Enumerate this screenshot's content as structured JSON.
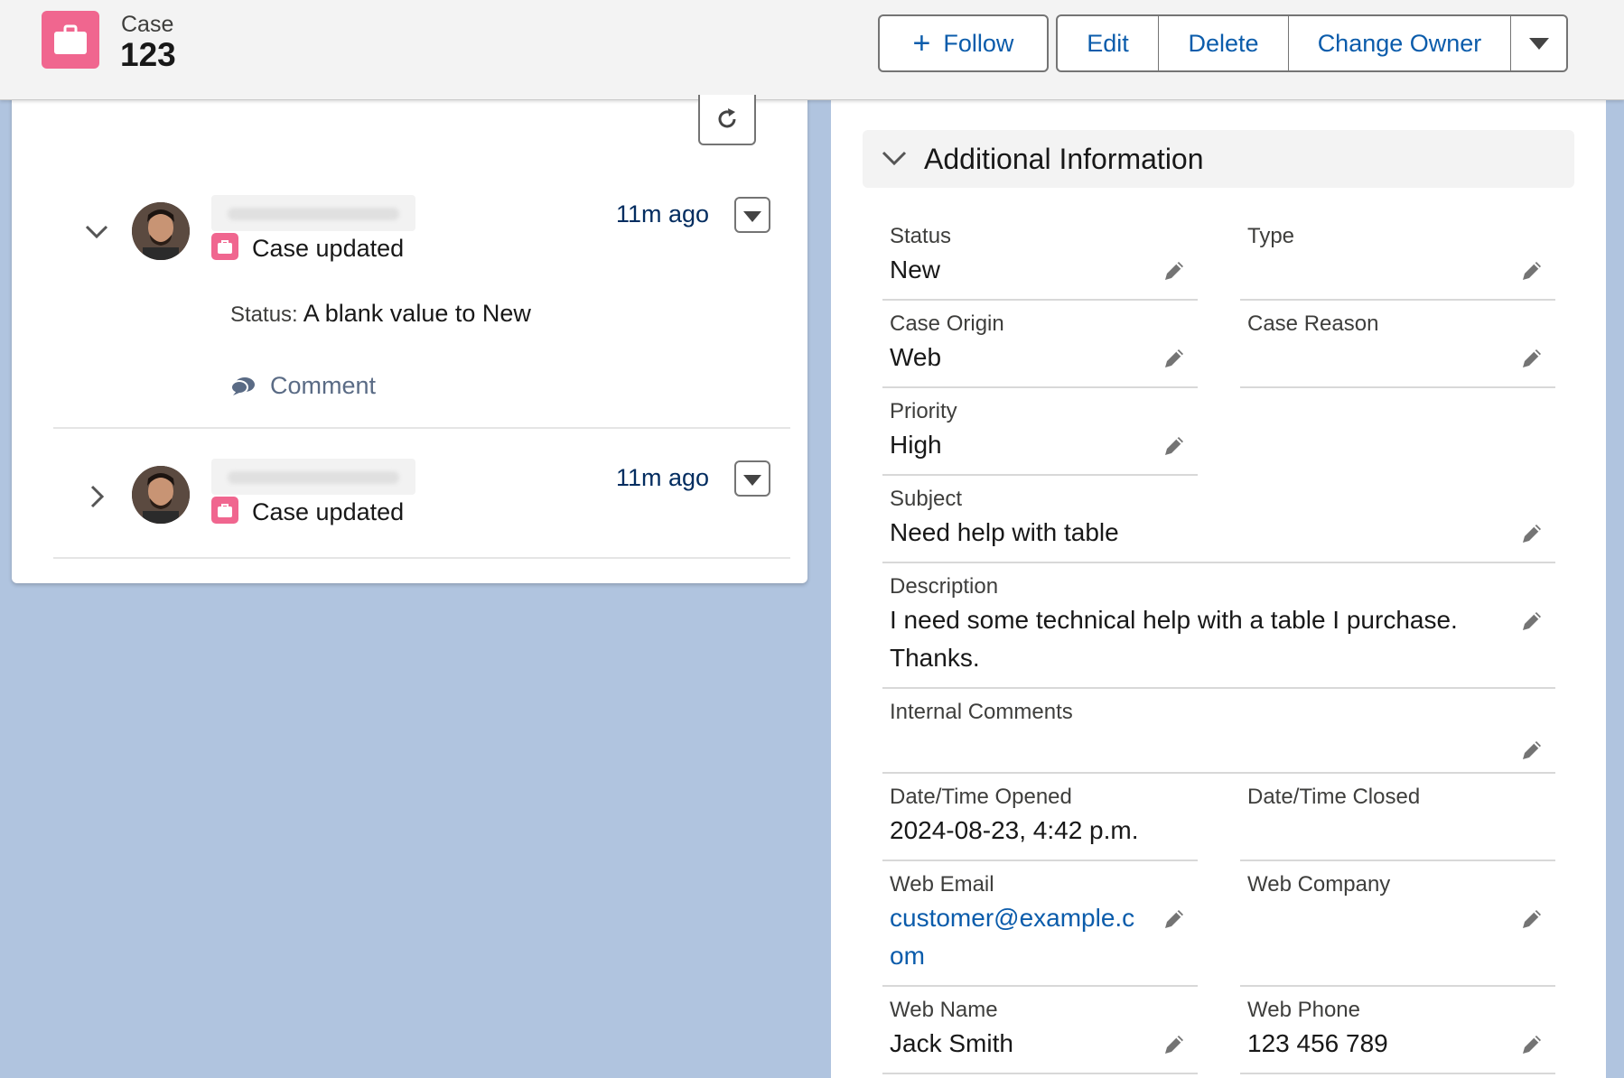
{
  "header": {
    "object_label": "Case",
    "record_title": "123",
    "buttons": {
      "follow": "Follow",
      "edit": "Edit",
      "delete": "Delete",
      "change_owner": "Change Owner"
    }
  },
  "feed": {
    "items": [
      {
        "expanded": true,
        "event": "Case updated",
        "time": "11m ago",
        "change_label": "Status:",
        "change_value": "A blank value to New",
        "comment_label": "Comment"
      },
      {
        "expanded": false,
        "event": "Case updated",
        "time": "11m ago"
      }
    ]
  },
  "details": {
    "section_title": "Additional Information",
    "fields": {
      "status": {
        "label": "Status",
        "value": "New"
      },
      "type": {
        "label": "Type",
        "value": ""
      },
      "case_origin": {
        "label": "Case Origin",
        "value": "Web"
      },
      "case_reason": {
        "label": "Case Reason",
        "value": ""
      },
      "priority": {
        "label": "Priority",
        "value": "High"
      },
      "subject": {
        "label": "Subject",
        "value": "Need help with table"
      },
      "description": {
        "label": "Description",
        "value_line1": "I need some technical help with a table I purchase.",
        "value_line2": "Thanks."
      },
      "internal_comments": {
        "label": "Internal Comments",
        "value": ""
      },
      "opened": {
        "label": "Date/Time Opened",
        "value": "2024-08-23, 4:42 p.m."
      },
      "closed": {
        "label": "Date/Time Closed",
        "value": ""
      },
      "web_email": {
        "label": "Web Email",
        "value_line1": "customer@example.c",
        "value_line2": "om"
      },
      "web_company": {
        "label": "Web Company",
        "value": ""
      },
      "web_name": {
        "label": "Web Name",
        "value": "Jack Smith"
      },
      "web_phone": {
        "label": "Web Phone",
        "value": "123 456 789"
      }
    }
  },
  "colors": {
    "brand_case": "#f0668f",
    "link": "#0b5cab",
    "background": "#b0c4df"
  }
}
